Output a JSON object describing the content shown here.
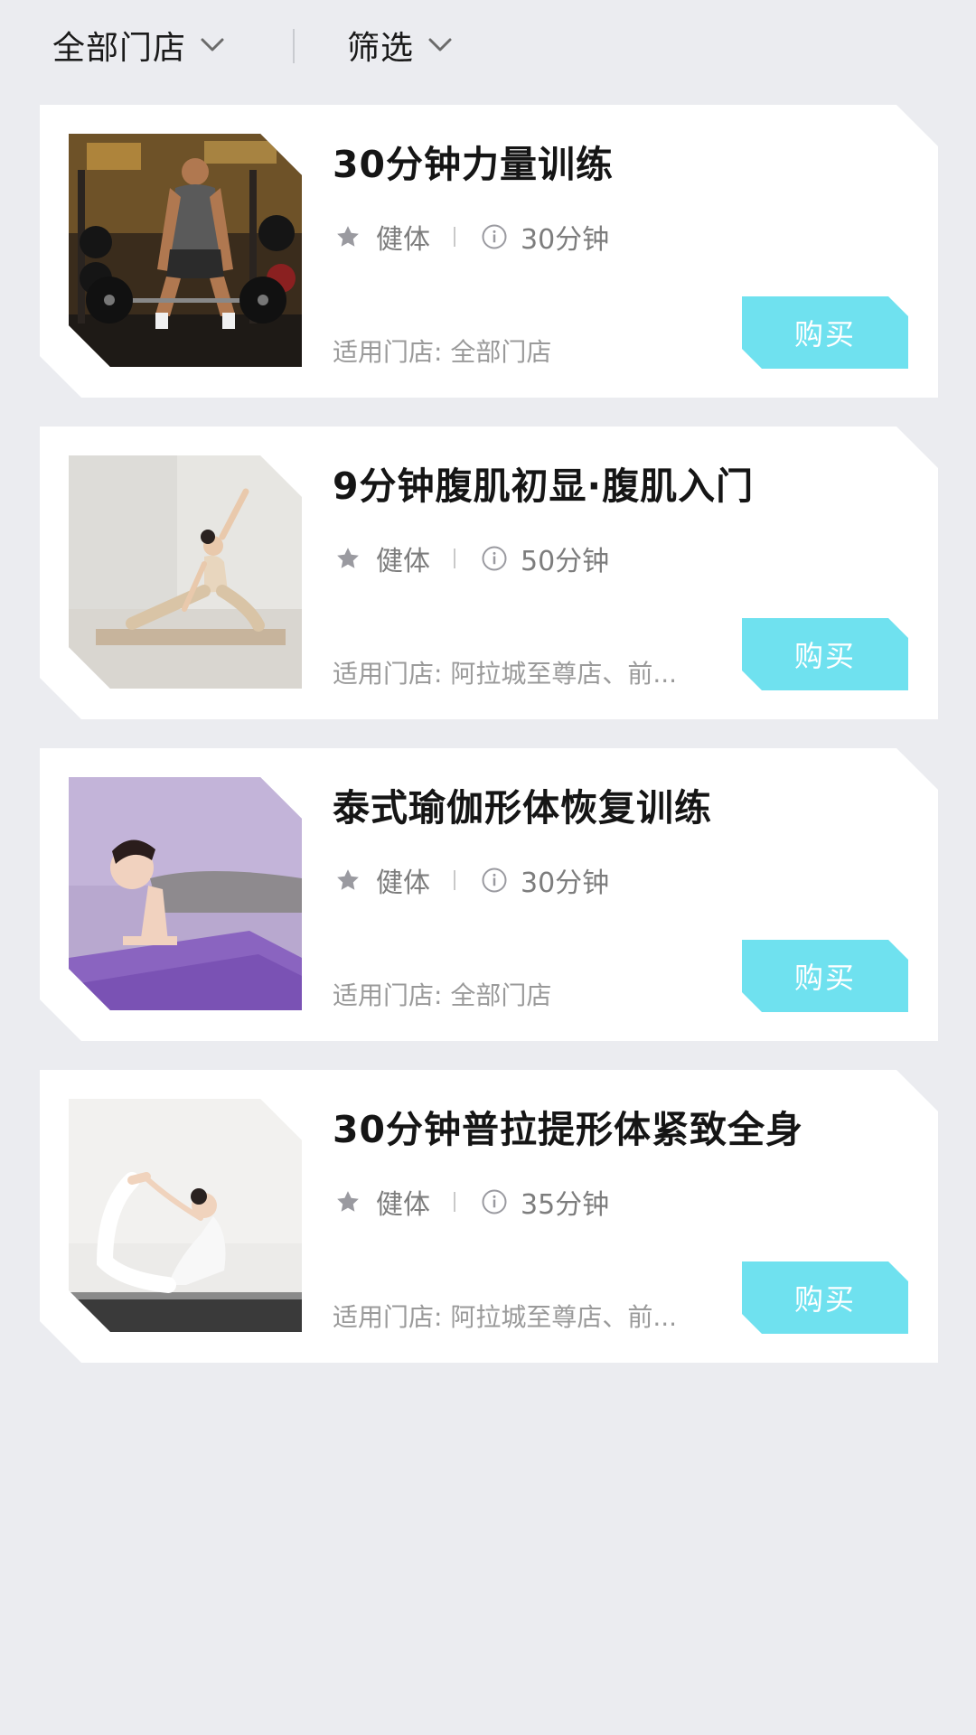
{
  "filters": {
    "store_label": "全部门店",
    "filter_label": "筛选"
  },
  "courses": [
    {
      "title": "30分钟力量训练",
      "category": "健体",
      "duration": "30分钟",
      "store": "适用门店: 全部门店",
      "buy_label": "购买",
      "thumb": "weightlifting-man-photo"
    },
    {
      "title": "9分钟腹肌初显·腹肌入门",
      "category": "健体",
      "duration": "50分钟",
      "store": "适用门店: 阿拉城至尊店、前...",
      "buy_label": "购买",
      "thumb": "yoga-stretch-photo"
    },
    {
      "title": "泰式瑜伽形体恢复训练",
      "category": "健体",
      "duration": "30分钟",
      "store": "适用门店: 全部门店",
      "buy_label": "购买",
      "thumb": "plank-woman-photo"
    },
    {
      "title": "30分钟普拉提形体紧致全身",
      "category": "健体",
      "duration": "35分钟",
      "store": "适用门店: 阿拉城至尊店、前...",
      "buy_label": "购买",
      "thumb": "bow-pose-photo"
    }
  ],
  "colors": {
    "background": "#ebecf0",
    "card": "#ffffff",
    "accent": "#6fe1ef",
    "meta_text": "#7d7d7d"
  },
  "icons": {
    "chevron": "chevron-down-icon",
    "category": "star-icon",
    "duration": "info-icon"
  }
}
